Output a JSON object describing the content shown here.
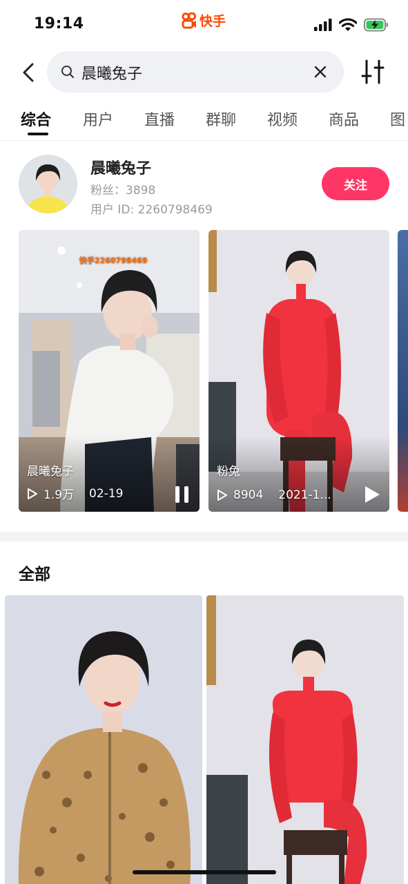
{
  "status_bar": {
    "time": "19:14",
    "brand": "快手",
    "icons": [
      "signal-icon",
      "wifi-icon",
      "battery-charging-icon"
    ]
  },
  "search": {
    "value": "晨曦兔子",
    "icons": [
      "back-arrow-icon",
      "search-icon",
      "clear-icon",
      "filter-sliders-icon"
    ]
  },
  "tabs": [
    {
      "label": "综合",
      "active": true
    },
    {
      "label": "用户",
      "active": false
    },
    {
      "label": "直播",
      "active": false
    },
    {
      "label": "群聊",
      "active": false
    },
    {
      "label": "视频",
      "active": false
    },
    {
      "label": "商品",
      "active": false
    },
    {
      "label": "图",
      "active": false
    }
  ],
  "user": {
    "name": "晨曦兔子",
    "fans": "粉丝：3898",
    "id": "用户 ID: 2260798469",
    "follow_label": "关注"
  },
  "featured_videos": [
    {
      "title": "晨曦兔子",
      "plays": "1.9万",
      "date": "02-19",
      "overlay_text": "快手2260798469",
      "action_icon": "pause-icon"
    },
    {
      "title": "粉兔",
      "plays": "8904",
      "date": "2021-1...",
      "action_icon": "play-icon"
    }
  ],
  "section": {
    "title": "全部"
  },
  "colors": {
    "brand": "#ff4906",
    "follow_button": "#fe3666",
    "tab_active": "#111111",
    "meta_text": "#9a9a9a"
  }
}
